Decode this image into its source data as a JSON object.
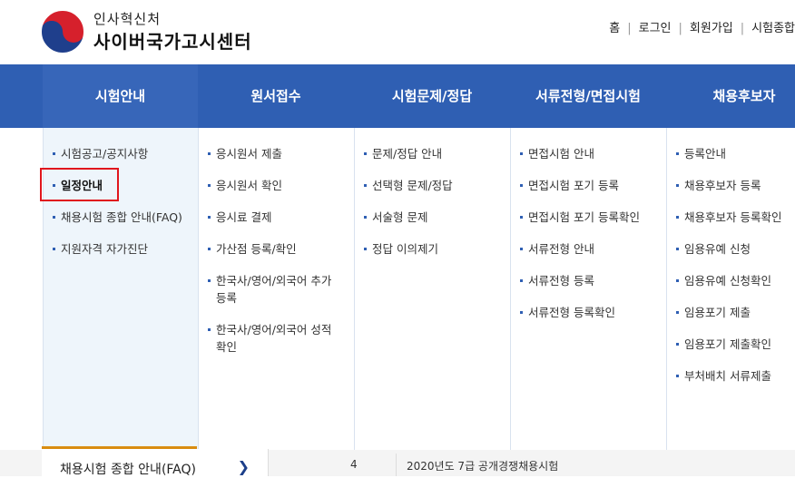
{
  "header": {
    "org_top": "인사혁신처",
    "org_name": "사이버국가고시센터",
    "util_links": [
      "홈",
      "로그인",
      "회원가입",
      "시험종합"
    ]
  },
  "nav": {
    "items": [
      "시험안내",
      "원서접수",
      "시험문제/정답",
      "서류전형/면접시험",
      "채용후보자"
    ]
  },
  "menus": [
    [
      "시험공고/공지사항",
      "일정안내",
      "채용시험 종합 안내(FAQ)",
      "지원자격 자가진단"
    ],
    [
      "응시원서 제출",
      "응시원서 확인",
      "응시료 결제",
      "가산점 등록/확인",
      "한국사/영어/외국어 추가등록",
      "한국사/영어/외국어 성적확인"
    ],
    [
      "문제/정답 안내",
      "선택형 문제/정답",
      "서술형 문제",
      "정답 이의제기"
    ],
    [
      "면접시험 안내",
      "면접시험 포기 등록",
      "면접시험 포기 등록확인",
      "서류전형 안내",
      "서류전형 등록",
      "서류전형 등록확인"
    ],
    [
      "등록안내",
      "채용후보자 등록",
      "채용후보자 등록확인",
      "임용유예 신청",
      "임용유예 신청확인",
      "임용포기 제출",
      "임용포기 제출확인",
      "부처배치 서류제출"
    ]
  ],
  "bottom": {
    "faq_label": "채용시험 종합 안내(FAQ)",
    "faq_arrow": "❯",
    "row_num": "4",
    "row_title": "2020년도 7급 공개경쟁채용시험"
  },
  "colors": {
    "nav_bg": "#2f5fb3",
    "highlight_border": "#e0161d",
    "accent_orange": "#d98c10"
  }
}
